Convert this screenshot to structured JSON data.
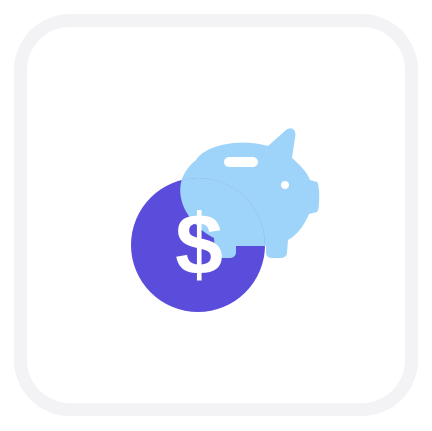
{
  "app_icon": {
    "name": "savings-icon",
    "tile_background": "#ffffff",
    "tile_border_color": "#f3f3f6",
    "piggy_bank_color": "#9fd4fa",
    "coin_color": "#5b4ddb",
    "coin_overlap_color": "#6f7ee8",
    "symbol": "$",
    "symbol_color": "#ffffff"
  }
}
